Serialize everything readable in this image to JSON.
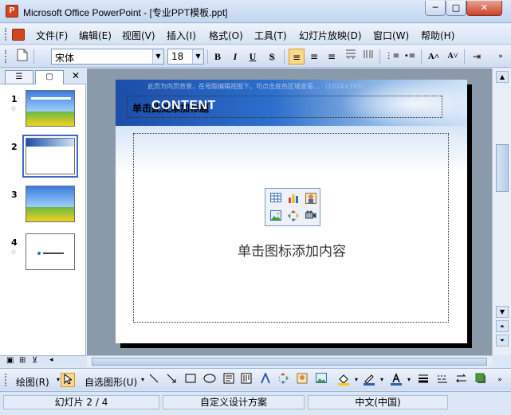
{
  "window": {
    "title": "Microsoft Office PowerPoint - [专业PPT模板.ppt]",
    "minimize_glyph": "─",
    "maximize_glyph": "□",
    "close_glyph": "✕",
    "app_icon_letter": "P"
  },
  "menu": {
    "items": [
      {
        "label": "文件(F)"
      },
      {
        "label": "编辑(E)"
      },
      {
        "label": "视图(V)"
      },
      {
        "label": "插入(I)"
      },
      {
        "label": "格式(O)"
      },
      {
        "label": "工具(T)"
      },
      {
        "label": "幻灯片放映(D)"
      },
      {
        "label": "窗口(W)"
      },
      {
        "label": "帮助(H)"
      }
    ]
  },
  "format_toolbar": {
    "font_name": "宋体",
    "font_size": "18",
    "bold": "B",
    "italic": "I",
    "underline": "U",
    "shadow": "S",
    "align_left": "≡",
    "align_center": "≡",
    "align_right": "≡",
    "numbering": "⋮≡",
    "bullets": "•≡",
    "increase_font": "A˄",
    "decrease_font": "A˅",
    "indent": "⇥",
    "align_left_active": true
  },
  "slide_pane": {
    "tab_outline_icon": "outline-icon",
    "tab_slides_icon": "slides-icon",
    "close_glyph": "✕",
    "star_glyph": "☆",
    "thumbnails": [
      {
        "number": "1",
        "has_star": true
      },
      {
        "number": "2",
        "has_star": false,
        "selected": true
      },
      {
        "number": "3",
        "has_star": false
      },
      {
        "number": "4",
        "has_star": true
      }
    ]
  },
  "slide": {
    "hint_text": "此页为内页背景，在母版编辑视图下，可点击底色区域查看... （1024×768）",
    "title_placeholder": "单击此处添加标题",
    "title_overlay": "CONTENT",
    "body_prompt": "单击图标添加内容",
    "content_icons": [
      "table-icon",
      "chart-icon",
      "clipart-icon",
      "picture-icon",
      "diagram-icon",
      "media-icon"
    ]
  },
  "draw_toolbar": {
    "draw_label": "绘图(R)",
    "autoshapes_label": "自选图形(U)"
  },
  "status": {
    "slide_info": "幻灯片 2 / 4",
    "design": "自定义设计方案",
    "language": "中文(中国)"
  }
}
